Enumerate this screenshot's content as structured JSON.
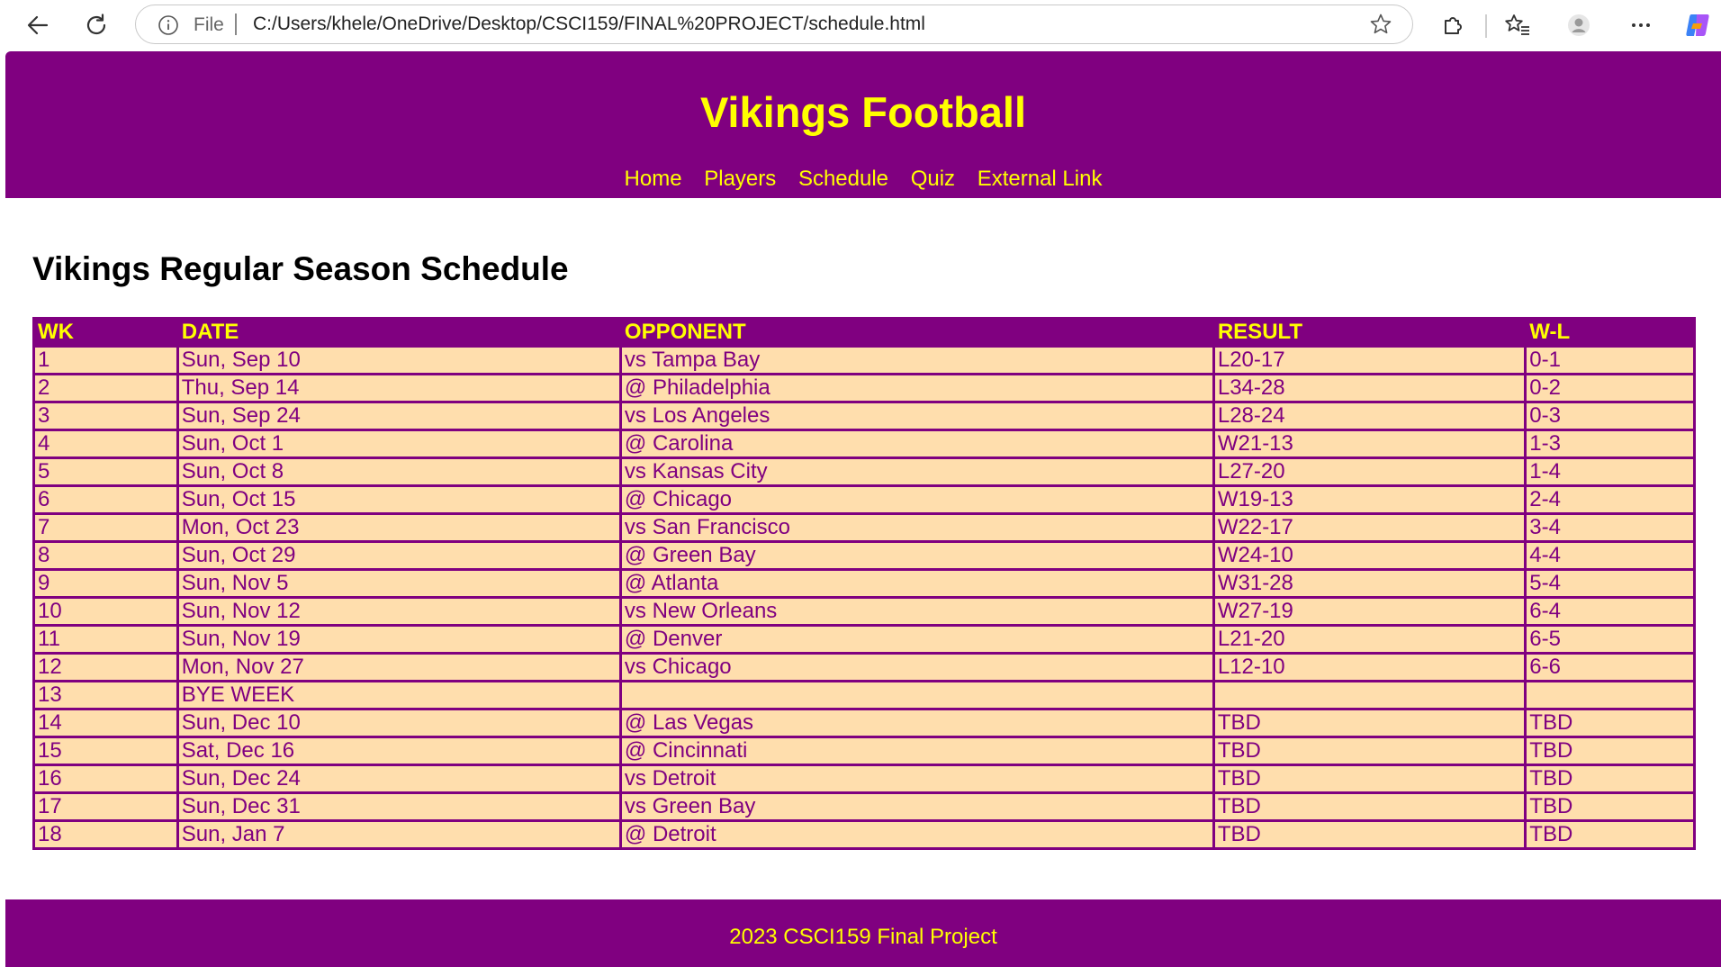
{
  "browser": {
    "file_label": "File",
    "url": "C:/Users/khele/OneDrive/Desktop/CSCI159/FINAL%20PROJECT/schedule.html"
  },
  "site": {
    "title": "Vikings Football",
    "nav": [
      "Home",
      "Players",
      "Schedule",
      "Quiz",
      "External Link"
    ],
    "footer": "2023 CSCI159 Final Project"
  },
  "main": {
    "heading": "Vikings Regular Season Schedule",
    "table": {
      "headers": [
        "WK",
        "DATE",
        "OPPONENT",
        "RESULT",
        "W-L"
      ],
      "rows": [
        [
          "1",
          "Sun, Sep 10",
          "vs Tampa Bay",
          "L20-17",
          "0-1"
        ],
        [
          "2",
          "Thu, Sep 14",
          "@ Philadelphia",
          "L34-28",
          "0-2"
        ],
        [
          "3",
          "Sun, Sep 24",
          "vs Los Angeles",
          "L28-24",
          "0-3"
        ],
        [
          "4",
          "Sun, Oct 1",
          "@ Carolina",
          "W21-13",
          "1-3"
        ],
        [
          "5",
          "Sun, Oct 8",
          "vs Kansas City",
          "L27-20",
          "1-4"
        ],
        [
          "6",
          "Sun, Oct 15",
          "@ Chicago",
          "W19-13",
          "2-4"
        ],
        [
          "7",
          "Mon, Oct 23",
          "vs San Francisco",
          "W22-17",
          "3-4"
        ],
        [
          "8",
          "Sun, Oct 29",
          "@ Green Bay",
          "W24-10",
          "4-4"
        ],
        [
          "9",
          "Sun, Nov 5",
          "@ Atlanta",
          "W31-28",
          "5-4"
        ],
        [
          "10",
          "Sun, Nov 12",
          "vs New Orleans",
          "W27-19",
          "6-4"
        ],
        [
          "11",
          "Sun, Nov 19",
          "@ Denver",
          "L21-20",
          "6-5"
        ],
        [
          "12",
          "Mon, Nov 27",
          "vs Chicago",
          "L12-10",
          "6-6"
        ],
        [
          "13",
          "BYE WEEK",
          "",
          "",
          ""
        ],
        [
          "14",
          "Sun, Dec 10",
          "@ Las Vegas",
          "TBD",
          "TBD"
        ],
        [
          "15",
          "Sat, Dec 16",
          "@ Cincinnati",
          "TBD",
          "TBD"
        ],
        [
          "16",
          "Sun, Dec 24",
          "vs Detroit",
          "TBD",
          "TBD"
        ],
        [
          "17",
          "Sun, Dec 31",
          "vs Green Bay",
          "TBD",
          "TBD"
        ],
        [
          "18",
          "Sun, Jan 7",
          "@ Detroit",
          "TBD",
          "TBD"
        ]
      ]
    }
  },
  "colors": {
    "brand_purple": "#800080",
    "accent_yellow": "#ffff00",
    "row_background": "#ffdead"
  },
  "icons": {
    "back": "back-arrow-icon",
    "reload": "reload-icon",
    "info": "info-icon",
    "favorite": "star-icon",
    "extensions": "extensions-icon",
    "favorites": "favorites-icon",
    "profile": "profile-icon",
    "more": "more-icon",
    "copilot": "copilot-icon"
  }
}
